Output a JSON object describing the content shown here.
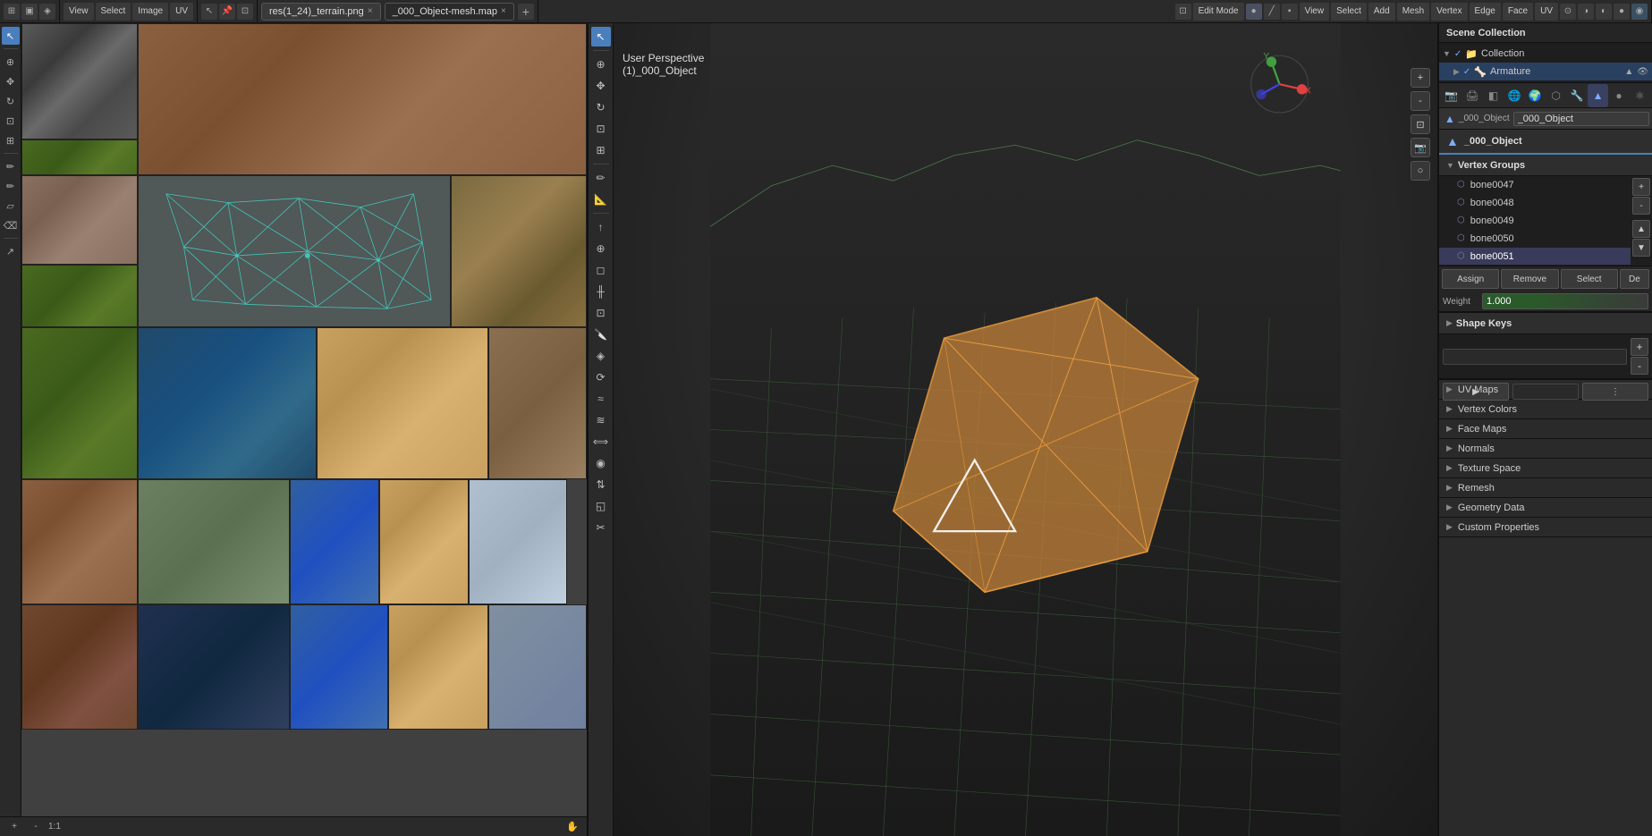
{
  "topbar": {
    "left_icons": [
      "▣",
      "⊞",
      "◈",
      "▤"
    ],
    "menus": [
      "View",
      "Select",
      "Image",
      "UV"
    ],
    "filename_tab": "res(1_24)_terrain.png",
    "second_tab": "_000_Object-mesh.map",
    "mode_label": "Edit Mode",
    "view_menu": "View",
    "select_menu": "Select",
    "add_menu": "Add",
    "mesh_menu": "Mesh",
    "vertex_menu": "Vertex",
    "edge_menu": "Edge",
    "face_menu": "Face",
    "uv_menu": "UV"
  },
  "viewport": {
    "perspective": "User Perspective",
    "object_name": "(1)_000_Object"
  },
  "right_panel": {
    "scene_collection": "Scene Collection",
    "collection": "Collection",
    "armature": "Armature",
    "active_object": "_000_Object",
    "mesh_data": "_000_Object",
    "vertex_groups_label": "Vertex Groups",
    "vertex_groups": [
      {
        "name": "bone0047"
      },
      {
        "name": "bone0048"
      },
      {
        "name": "bone0049"
      },
      {
        "name": "bone0050"
      },
      {
        "name": "bone0051",
        "selected": true
      }
    ],
    "assign_btn": "Assign",
    "remove_btn": "Remove",
    "select_btn": "Select",
    "deselect_btn": "De",
    "weight_label": "Weight",
    "weight_value": "1.000",
    "shape_keys_label": "Shape Keys",
    "uv_maps_label": "UV Maps",
    "vertex_colors_label": "Vertex Colors",
    "face_maps_label": "Face Maps",
    "normals_label": "Normals",
    "texture_space_label": "Texture Space",
    "remesh_label": "Remesh",
    "geometry_data_label": "Geometry Data",
    "custom_properties_label": "Custom Properties"
  }
}
